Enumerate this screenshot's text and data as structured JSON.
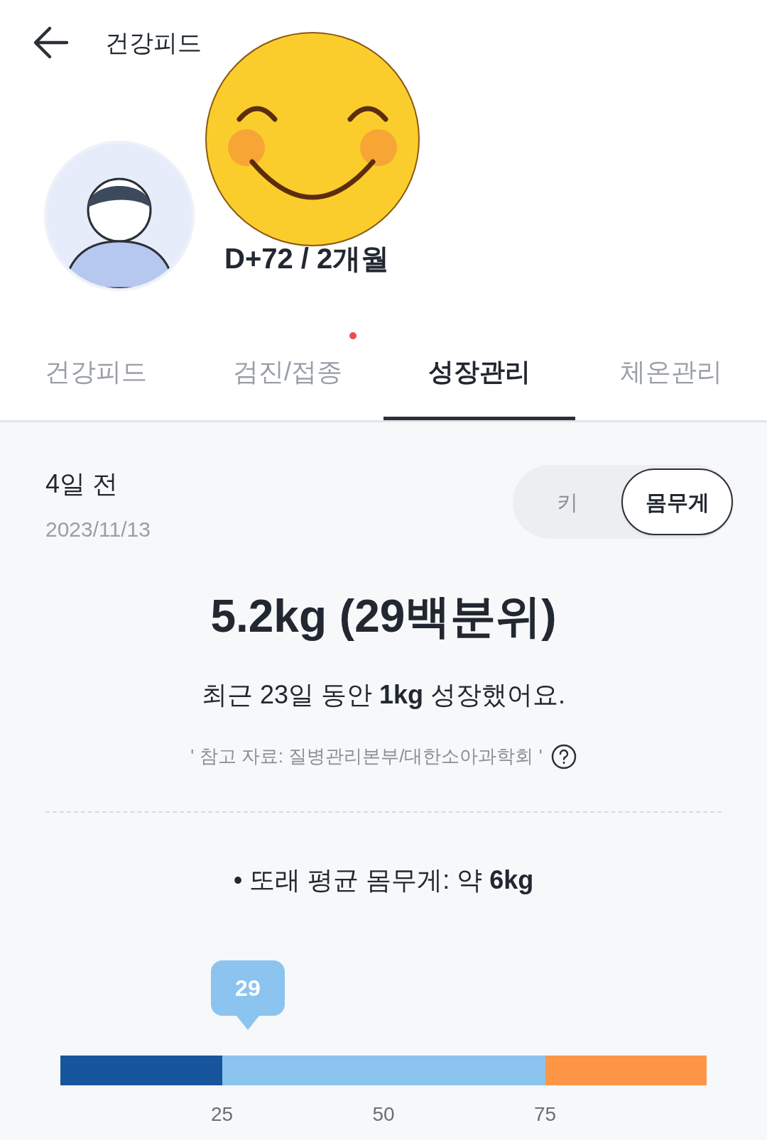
{
  "header": {
    "title": "건강피드"
  },
  "profile": {
    "age": "D+72 / 2개월"
  },
  "tabs": [
    {
      "label": "건강피드",
      "selected": false,
      "badge": false
    },
    {
      "label": "검진/접종",
      "selected": false,
      "badge": true
    },
    {
      "label": "성장관리",
      "selected": true,
      "badge": false
    },
    {
      "label": "체온관리",
      "selected": false,
      "badge": false
    }
  ],
  "record": {
    "when": "4일 전",
    "date": "2023/11/13"
  },
  "toggle": [
    {
      "label": "키",
      "selected": false
    },
    {
      "label": "몸무게",
      "selected": true
    }
  ],
  "summary": {
    "headline": "5.2kg (29백분위)",
    "growth": "최근 23일 동안 **1kg** 성장했어요.",
    "source": "' 참고 자료: 질병관리본부/대한소아과학회 '"
  },
  "peer_average": "• 또래 평균 몸무게: 약 **6kg**",
  "percentile": {
    "marker": "29",
    "ticks": [
      "25",
      "50",
      "75"
    ]
  }
}
